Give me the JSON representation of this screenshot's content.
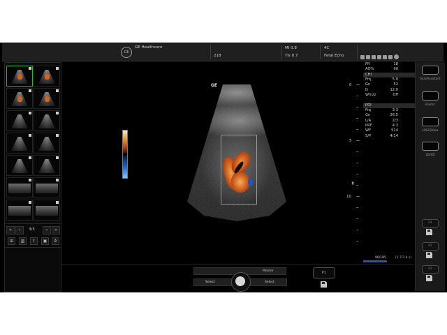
{
  "topbar": {
    "brand": "GE Healthcare",
    "field_id": "218",
    "mi": "MI 0.8",
    "tis": "TIs 0.7",
    "probe": "4C",
    "preset": "Fetal Echo"
  },
  "image": {
    "ge_mark": "GE"
  },
  "depth_labels": [
    "0",
    "5",
    "10"
  ],
  "params": {
    "top": [
      {
        "k": "FR",
        "v": "18"
      },
      {
        "k": "AO%",
        "v": "90"
      }
    ],
    "chi_title": "CHI",
    "chi": [
      {
        "k": "Frq",
        "v": "5.0"
      },
      {
        "k": "Gn",
        "v": "52"
      },
      {
        "k": "D",
        "v": "12.0"
      },
      {
        "k": "Whizz",
        "v": "Off"
      }
    ],
    "pdi_title": "PDI",
    "pdi": [
      {
        "k": "Frq",
        "v": "3.3"
      },
      {
        "k": "Gn",
        "v": "26.5"
      },
      {
        "k": "L/A",
        "v": "2/3"
      },
      {
        "k": "PRF",
        "v": "4.3"
      },
      {
        "k": "WF",
        "v": "514"
      },
      {
        "k": "S/P",
        "v": "4/14"
      }
    ]
  },
  "cine": {
    "frames": "90/185",
    "time": "(1.7/3.4 s)"
  },
  "thumbs": {
    "pager": "3/5"
  },
  "right_panel": {
    "scan_assistant": "ScanAssistant",
    "elastic": "Elastic",
    "logiqview": "LOGIQView",
    "3d4d": "3D/4D",
    "f4": "F4",
    "p3": "P3",
    "p2": "P2"
  },
  "bottom": {
    "pointer": "Pointer",
    "select_left": "Select",
    "select_right": "Select",
    "p1": "P1"
  },
  "colors": {
    "roi_orange": "#e0782a",
    "focus": "#e4d33c",
    "selected_thumb": "#29b32f",
    "cine_bar": "#2255c3"
  }
}
